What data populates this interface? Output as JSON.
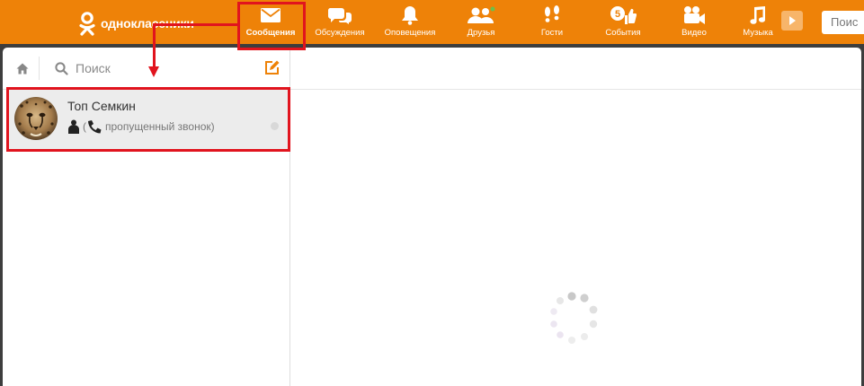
{
  "app": {
    "logo_text": "одноклассники",
    "search_placeholder": "Поис"
  },
  "nav": [
    {
      "label": "Сообщения",
      "icon": "envelope-icon",
      "active": true
    },
    {
      "label": "Обсуждения",
      "icon": "speech-bubbles-icon"
    },
    {
      "label": "Оповещения",
      "icon": "bell-icon"
    },
    {
      "label": "Друзья",
      "icon": "people-icon"
    },
    {
      "label": "Гости",
      "icon": "footprints-icon"
    },
    {
      "label": "События",
      "icon": "events-icon",
      "badge": "5"
    },
    {
      "label": "Видео",
      "icon": "video-camera-icon"
    },
    {
      "label": "Музыка",
      "icon": "music-note-icon"
    }
  ],
  "chat_panel": {
    "search_label": "Поиск",
    "chats": [
      {
        "name": "Топ Семкин",
        "status": "пропущенный звонок)",
        "status_prefix": "("
      }
    ]
  },
  "colors": {
    "brand": "#ee8208",
    "highlight": "#e1141e"
  }
}
